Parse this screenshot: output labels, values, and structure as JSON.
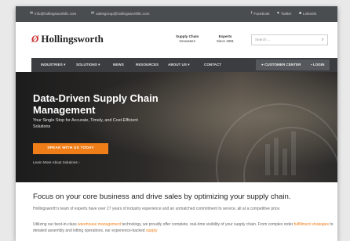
{
  "topbar": {
    "email1": "info@hollingsworthllc.com",
    "email2": "salesgroup@hollingsworthllc.com",
    "social": [
      "Facebook",
      "Twitter",
      "LinkedIn"
    ]
  },
  "brand": {
    "logo_mark": "Ø",
    "name": "Hollingsworth"
  },
  "badges": [
    {
      "title": "Supply Chain",
      "sub": "Innovators"
    },
    {
      "title": "Experts",
      "sub": "Since 1991"
    }
  ],
  "search": {
    "placeholder": "Search ..."
  },
  "nav": {
    "items": [
      "INDUSTRIES",
      "SOLUTIONS",
      "NEWS",
      "RESOURCES",
      "ABOUT US",
      "CONTACT"
    ],
    "customer_center": "CUSTOMER CENTER",
    "login": "LOGIN"
  },
  "hero": {
    "title": "Data-Driven Supply Chain Management",
    "subtitle": "Your Single Stop for Accurate, Timely, and Cost-Efficient Solutions",
    "cta": "SPEAK WITH US TODAY",
    "link": "Learn More About Solutions ›"
  },
  "content": {
    "heading": "Focus on your core business and drive sales by optimizing your supply chain.",
    "p1": "Hollingsworth's team of experts have over 27 years of industry experience and an unmatched commitment to service, all at a competitive price.",
    "p2_a": "Utilizing our best-in-class ",
    "p2_hl1": "warehouse management",
    "p2_b": " technology, we proudly offer complete, real-time visibility of your supply chain. From complex order ",
    "p2_hl2": "fulfillment strategies",
    "p2_c": " to detailed assembly and kitting operations, our experience-backed ",
    "p2_hl3": "supply"
  },
  "colors": {
    "accent": "#ef7d18",
    "topbar": "#4a4d50",
    "nav": "#3b3d40"
  }
}
